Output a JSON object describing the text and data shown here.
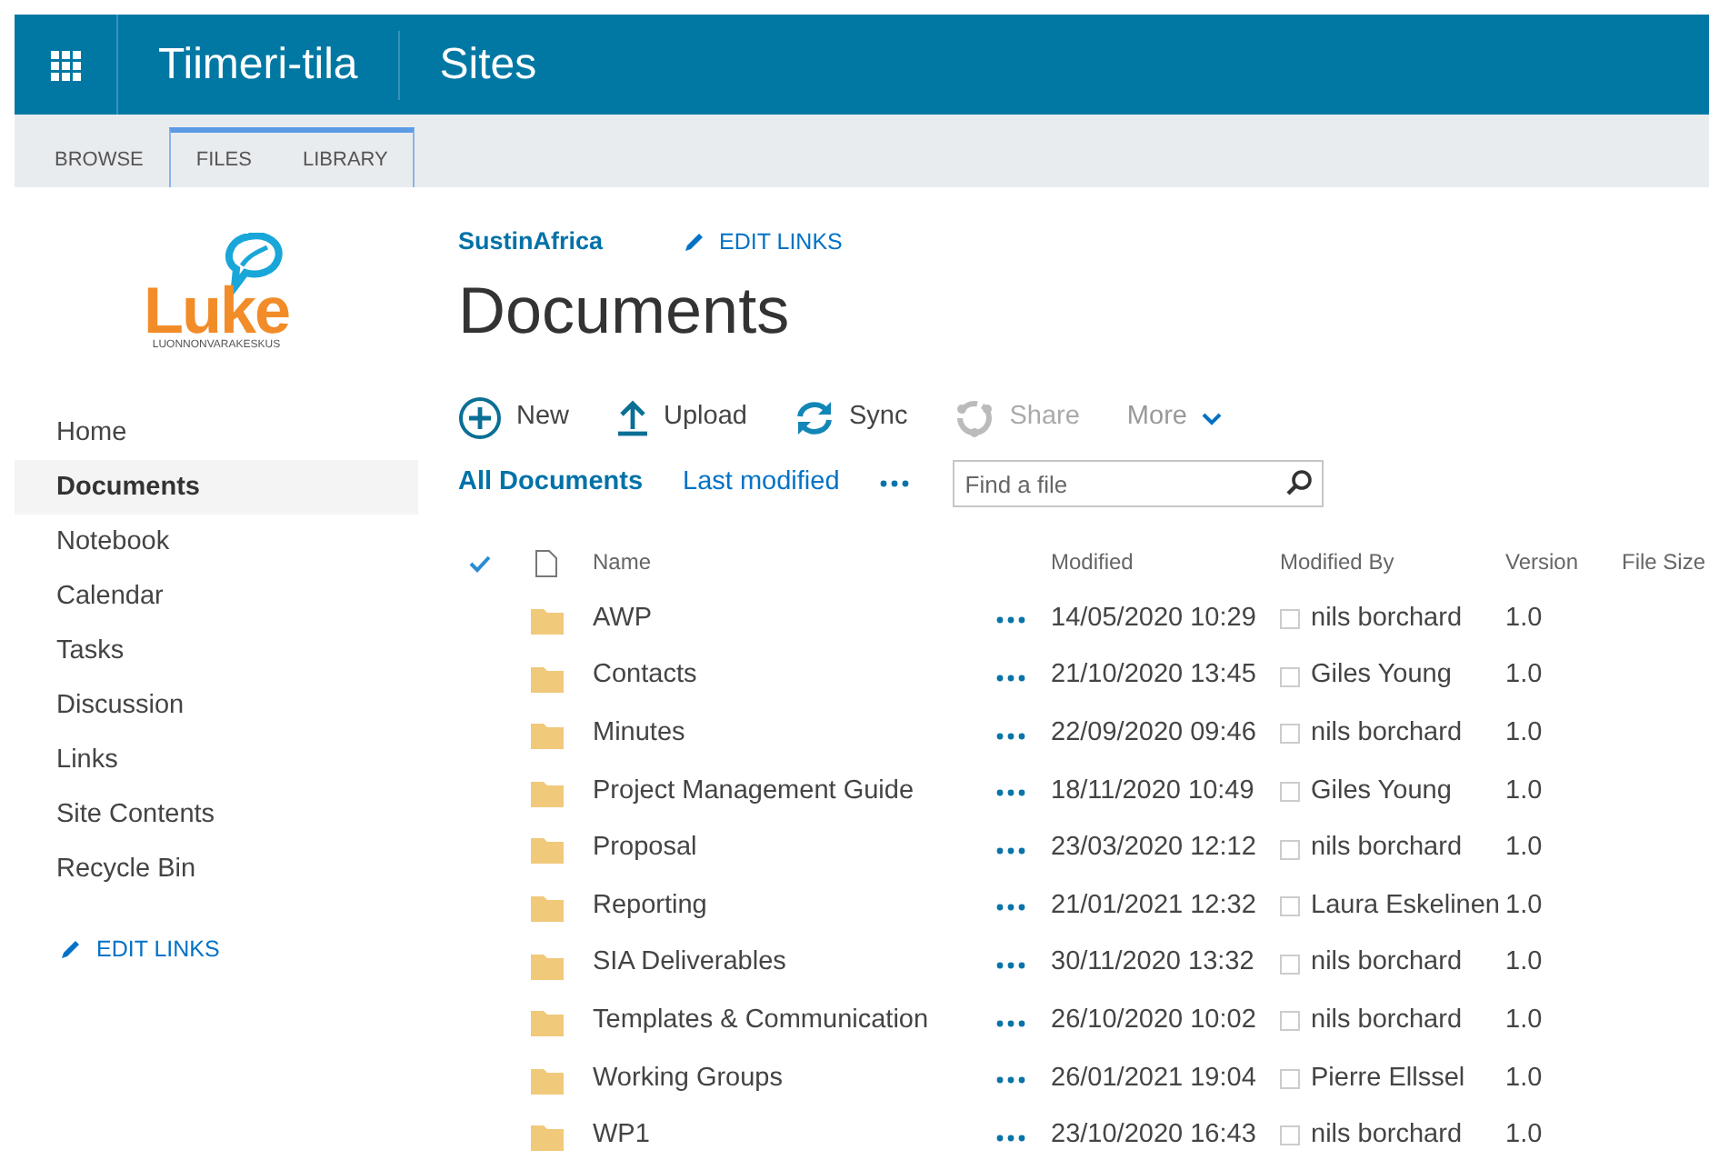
{
  "suite_bar": {
    "site_title": "Tiimeri-tila",
    "section": "Sites"
  },
  "ribbon_tabs": [
    {
      "label": "BROWSE",
      "contextual": false
    },
    {
      "label": "FILES",
      "contextual": true
    },
    {
      "label": "LIBRARY",
      "contextual": true
    }
  ],
  "logo": {
    "wordmark": "Luke",
    "tagline": "LUONNONVARAKESKUS"
  },
  "breadcrumb": {
    "site_link": "SustinAfrica",
    "edit_links": "EDIT LINKS"
  },
  "page_title": "Documents",
  "quick_launch": [
    {
      "label": "Home",
      "selected": false
    },
    {
      "label": "Documents",
      "selected": true
    },
    {
      "label": "Notebook",
      "selected": false
    },
    {
      "label": "Calendar",
      "selected": false
    },
    {
      "label": "Tasks",
      "selected": false
    },
    {
      "label": "Discussion",
      "selected": false
    },
    {
      "label": "Links",
      "selected": false
    },
    {
      "label": "Site Contents",
      "selected": false
    },
    {
      "label": "Recycle Bin",
      "selected": false
    }
  ],
  "quick_launch_edit": "EDIT LINKS",
  "commands": [
    {
      "kind": "new",
      "label": "New",
      "disabled": false
    },
    {
      "kind": "upload",
      "label": "Upload",
      "disabled": false
    },
    {
      "kind": "sync",
      "label": "Sync",
      "disabled": false
    },
    {
      "kind": "share",
      "label": "Share",
      "disabled": true
    },
    {
      "kind": "more",
      "label": "More",
      "disabled": false
    }
  ],
  "views": [
    {
      "label": "All Documents",
      "selected": true
    },
    {
      "label": "Last modified",
      "selected": false
    }
  ],
  "search": {
    "placeholder": "Find a file"
  },
  "table": {
    "columns": [
      "Name",
      "Modified",
      "Modified By",
      "Version",
      "File Size"
    ],
    "rows": [
      {
        "name": "AWP",
        "modified": "14/05/2020 10:29",
        "modified_by": "nils borchard",
        "version": "1.0"
      },
      {
        "name": "Contacts",
        "modified": "21/10/2020 13:45",
        "modified_by": "Giles Young",
        "version": "1.0"
      },
      {
        "name": "Minutes",
        "modified": "22/09/2020 09:46",
        "modified_by": "nils borchard",
        "version": "1.0"
      },
      {
        "name": "Project Management Guide",
        "modified": "18/11/2020 10:49",
        "modified_by": "Giles Young",
        "version": "1.0"
      },
      {
        "name": "Proposal",
        "modified": "23/03/2020 12:12",
        "modified_by": "nils borchard",
        "version": "1.0"
      },
      {
        "name": "Reporting",
        "modified": "21/01/2021 12:32",
        "modified_by": "Laura Eskelinen",
        "version": "1.0"
      },
      {
        "name": "SIA Deliverables",
        "modified": "30/11/2020 13:32",
        "modified_by": "nils borchard",
        "version": "1.0"
      },
      {
        "name": "Templates & Communication",
        "modified": "26/10/2020 10:02",
        "modified_by": "nils borchard",
        "version": "1.0"
      },
      {
        "name": "Working Groups",
        "modified": "26/01/2021 19:04",
        "modified_by": "Pierre Ellssel",
        "version": "1.0"
      },
      {
        "name": "WP1",
        "modified": "23/10/2020 16:43",
        "modified_by": "nils borchard",
        "version": "1.0"
      }
    ]
  }
}
